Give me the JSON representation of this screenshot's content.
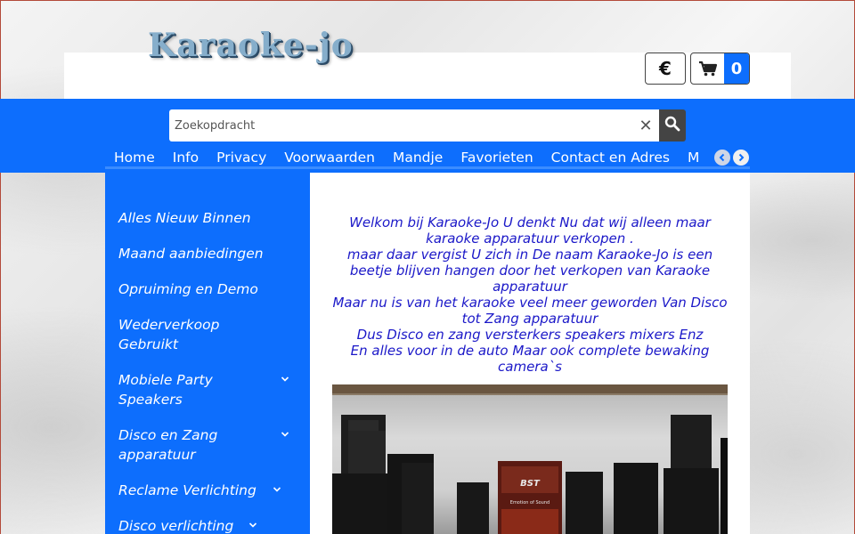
{
  "header": {
    "logo_text": "Karaoke-jo",
    "currency_symbol": "€",
    "cart_count": "0"
  },
  "search": {
    "placeholder": "Zoekopdracht",
    "clear_symbol": "✕"
  },
  "nav": {
    "items": [
      "Home",
      "Info",
      "Privacy",
      "Voorwaarden",
      "Mandje",
      "Favorieten",
      "Contact en Adres",
      "M"
    ]
  },
  "sidebar": {
    "items": [
      {
        "label": "Alles Nieuw Binnen",
        "has_submenu": false
      },
      {
        "label": "Maand aanbiedingen",
        "has_submenu": false
      },
      {
        "label": "Opruiming en Demo",
        "has_submenu": false
      },
      {
        "label": "Wederverkoop Gebruikt",
        "has_submenu": false
      },
      {
        "label": "Mobiele Party Speakers",
        "has_submenu": true
      },
      {
        "label": "Disco en Zang apparatuur",
        "has_submenu": true
      },
      {
        "label": "Reclame Verlichting",
        "has_submenu": true
      },
      {
        "label": "Disco verlichting",
        "has_submenu": true
      }
    ]
  },
  "content": {
    "welcome_lines": [
      "Welkom bij Karaoke-Jo U denkt Nu dat wij alleen maar karaoke apparatuur verkopen .",
      "maar daar vergist U zich in De naam Karaoke-Jo is een beetje blijven hangen door het verkopen van Karaoke apparatuur",
      "Maar nu is van het karaoke veel meer geworden Van Disco tot Zang apparatuur",
      "Dus Disco en zang versterkers speakers mixers Enz",
      "En alles voor in de auto Maar ook complete bewaking camera`s"
    ],
    "banner_brand": "BST",
    "banner_tagline": "Emotion of Sound"
  },
  "colors": {
    "brand_blue": "#0d6efd",
    "text_blue": "#1b18c8",
    "dark_button": "#444444"
  }
}
